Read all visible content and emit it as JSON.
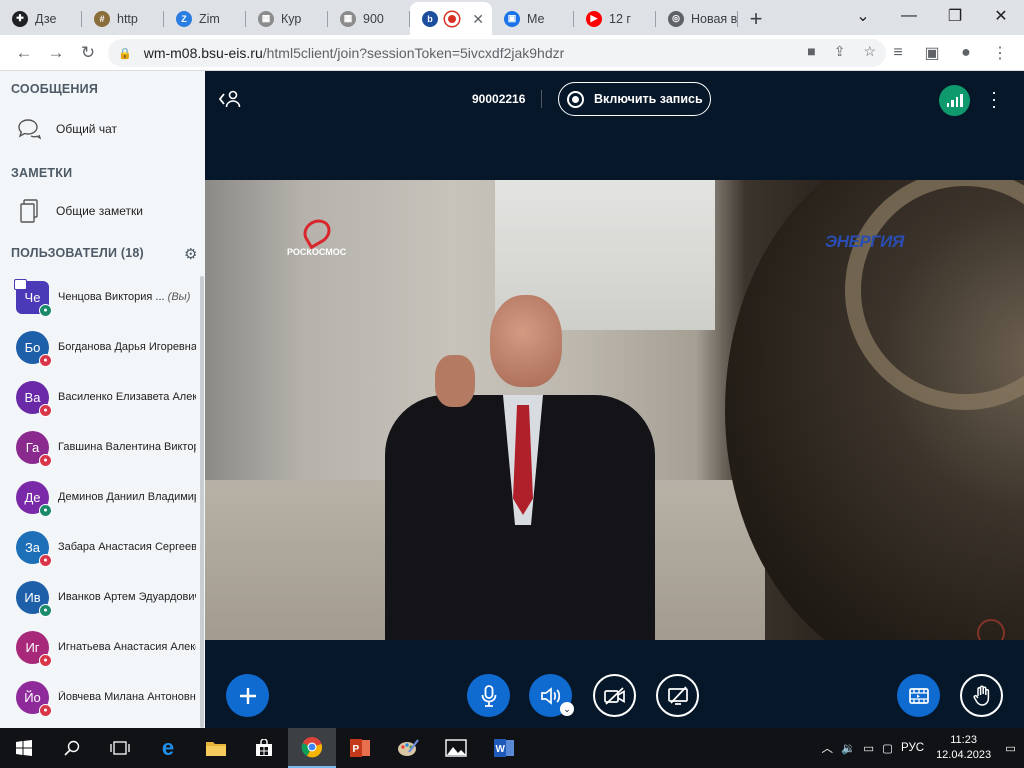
{
  "browser": {
    "tabs": [
      {
        "title": "Дзе",
        "fav_color": "#202124",
        "fav_glyph": "✚"
      },
      {
        "title": "http",
        "fav_color": "#8a6d3b",
        "fav_glyph": "#"
      },
      {
        "title": "Zim",
        "fav_color": "#2a7de1",
        "fav_glyph": "Z"
      },
      {
        "title": "Кур",
        "fav_color": "#8c8c8c",
        "fav_glyph": "▦"
      },
      {
        "title": "900",
        "fav_color": "#8c8c8c",
        "fav_glyph": "▦"
      },
      {
        "title": "",
        "fav_color": "#1d4f9e",
        "fav_glyph": "b",
        "active": true
      },
      {
        "title": "Ме",
        "fav_color": "#1a73e8",
        "fav_glyph": "▣"
      },
      {
        "title": "12 г",
        "fav_color": "#ff0000",
        "fav_glyph": "▶"
      },
      {
        "title": "Новая в",
        "fav_color": "#5f6368",
        "fav_glyph": "◎"
      }
    ],
    "url_host": "wm-m08.bsu-eis.ru",
    "url_rest": "/html5client/join?sessionToken=5ivcxdf2jak9hdzr"
  },
  "sidebar": {
    "messages_header": "СООБЩЕНИЯ",
    "public_chat": "Общий чат",
    "notes_header": "ЗАМЕТКИ",
    "shared_notes": "Общие заметки",
    "users_header": "ПОЛЬЗОВАТЕЛИ (18)",
    "users": [
      {
        "initials": "Че",
        "name": "Ченцова Виктория ...",
        "you": "(Вы)",
        "color": "#4a3ab8",
        "mic": "#1b8a6a",
        "square": true
      },
      {
        "initials": "Бо",
        "name": "Богданова Дарья Игоревна",
        "you": "",
        "color": "#1d5fa8",
        "mic": "#d9364a",
        "square": false
      },
      {
        "initials": "Ва",
        "name": "Василенко Елизавета Александровна",
        "you": "",
        "color": "#6a2aa8",
        "mic": "#d9364a",
        "square": false
      },
      {
        "initials": "Га",
        "name": "Гавшина Валентина Викторовна",
        "you": "",
        "color": "#8a2a8e",
        "mic": "#d9364a",
        "square": false
      },
      {
        "initials": "Де",
        "name": "Деминов Даниил Владимирович",
        "you": "",
        "color": "#7a2aa8",
        "mic": "#1b8a6a",
        "square": false
      },
      {
        "initials": "За",
        "name": "Забара Анастасия Сергеевна",
        "you": "",
        "color": "#1d6fb8",
        "mic": "#d9364a",
        "square": false
      },
      {
        "initials": "Ив",
        "name": "Иванков Артем Эдуардович",
        "you": "",
        "color": "#1d5fa8",
        "mic": "#1b8a6a",
        "square": false
      },
      {
        "initials": "Иг",
        "name": "Игнатьева Анастасия Александровна",
        "you": "",
        "color": "#a8287a",
        "mic": "#d9364a",
        "square": false
      },
      {
        "initials": "Йо",
        "name": "Йовчева Милана Антоновна",
        "you": "",
        "color": "#8e2a9a",
        "mic": "#d9364a",
        "square": false
      }
    ]
  },
  "meeting": {
    "number": "90002216",
    "record_label": "Включить запись",
    "video_logo_left": "РОСКОСМОС",
    "video_logo_right": "ЭНЕРГИЯ"
  },
  "taskbar": {
    "lang": "РУС",
    "time": "11:23",
    "date": "12.04.2023"
  }
}
